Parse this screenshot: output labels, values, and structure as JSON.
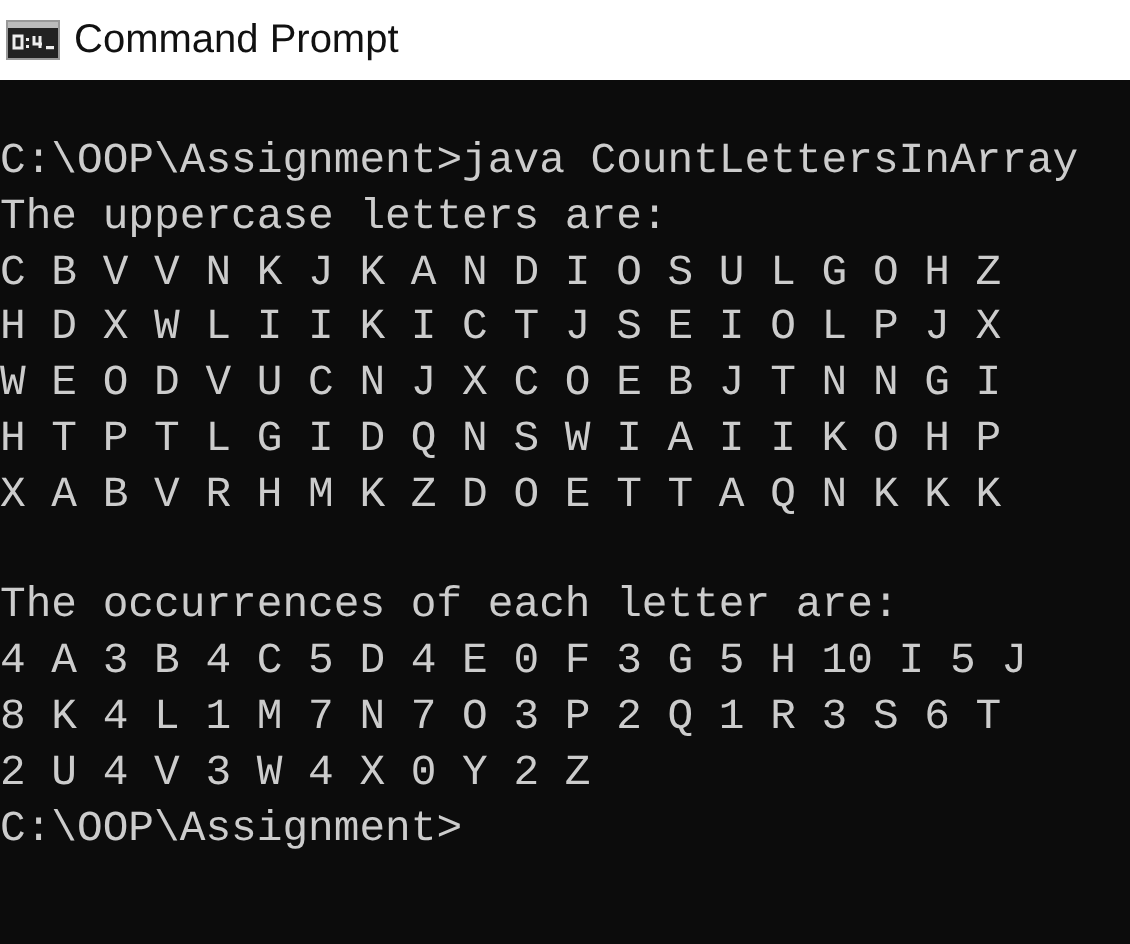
{
  "window": {
    "title": "Command Prompt"
  },
  "console": {
    "paragraphs": [
      [
        "C:\\OOP\\Assignment>java CountLettersInArray",
        "The uppercase letters are:",
        "C B V V N K J K A N D I O S U L G O H Z",
        "H D X W L I I K I C T J S E I O L P J X",
        "W E O D V U C N J X C O E B J T N N G I",
        "H T P T L G I D Q N S W I A I I K O H P",
        "X A B V R H M K Z D O E T T A Q N K K K"
      ],
      [
        "The occurrences of each letter are:",
        "4 A 3 B 4 C 5 D 4 E 0 F 3 G 5 H 10 I 5 J",
        "8 K 4 L 1 M 7 N 7 O 3 P 2 Q 1 R 3 S 6 T",
        "2 U 4 V 3 W 4 X 0 Y 2 Z",
        "C:\\OOP\\Assignment>"
      ]
    ]
  }
}
